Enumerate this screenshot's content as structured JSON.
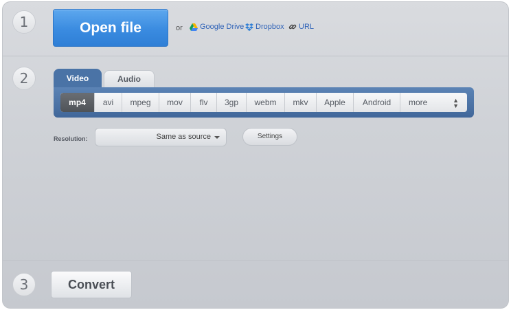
{
  "steps": {
    "one": "1",
    "two": "2",
    "three": "3"
  },
  "open": {
    "button_label": "Open file",
    "or_label": "or",
    "sources": {
      "google_drive": "Google Drive",
      "dropbox": "Dropbox",
      "url": "URL"
    }
  },
  "tabs": {
    "video": "Video",
    "audio": "Audio"
  },
  "formats": [
    "mp4",
    "avi",
    "mpeg",
    "mov",
    "flv",
    "3gp",
    "webm",
    "mkv",
    "Apple",
    "Android",
    "more"
  ],
  "selected_format": "mp4",
  "resolution": {
    "label": "Resolution:",
    "value": "Same as source"
  },
  "settings_label": "Settings",
  "convert_label": "Convert",
  "colors": {
    "open_button": "#3a8be0",
    "active_tab": "#4a73a6",
    "link": "#2f63b8"
  }
}
